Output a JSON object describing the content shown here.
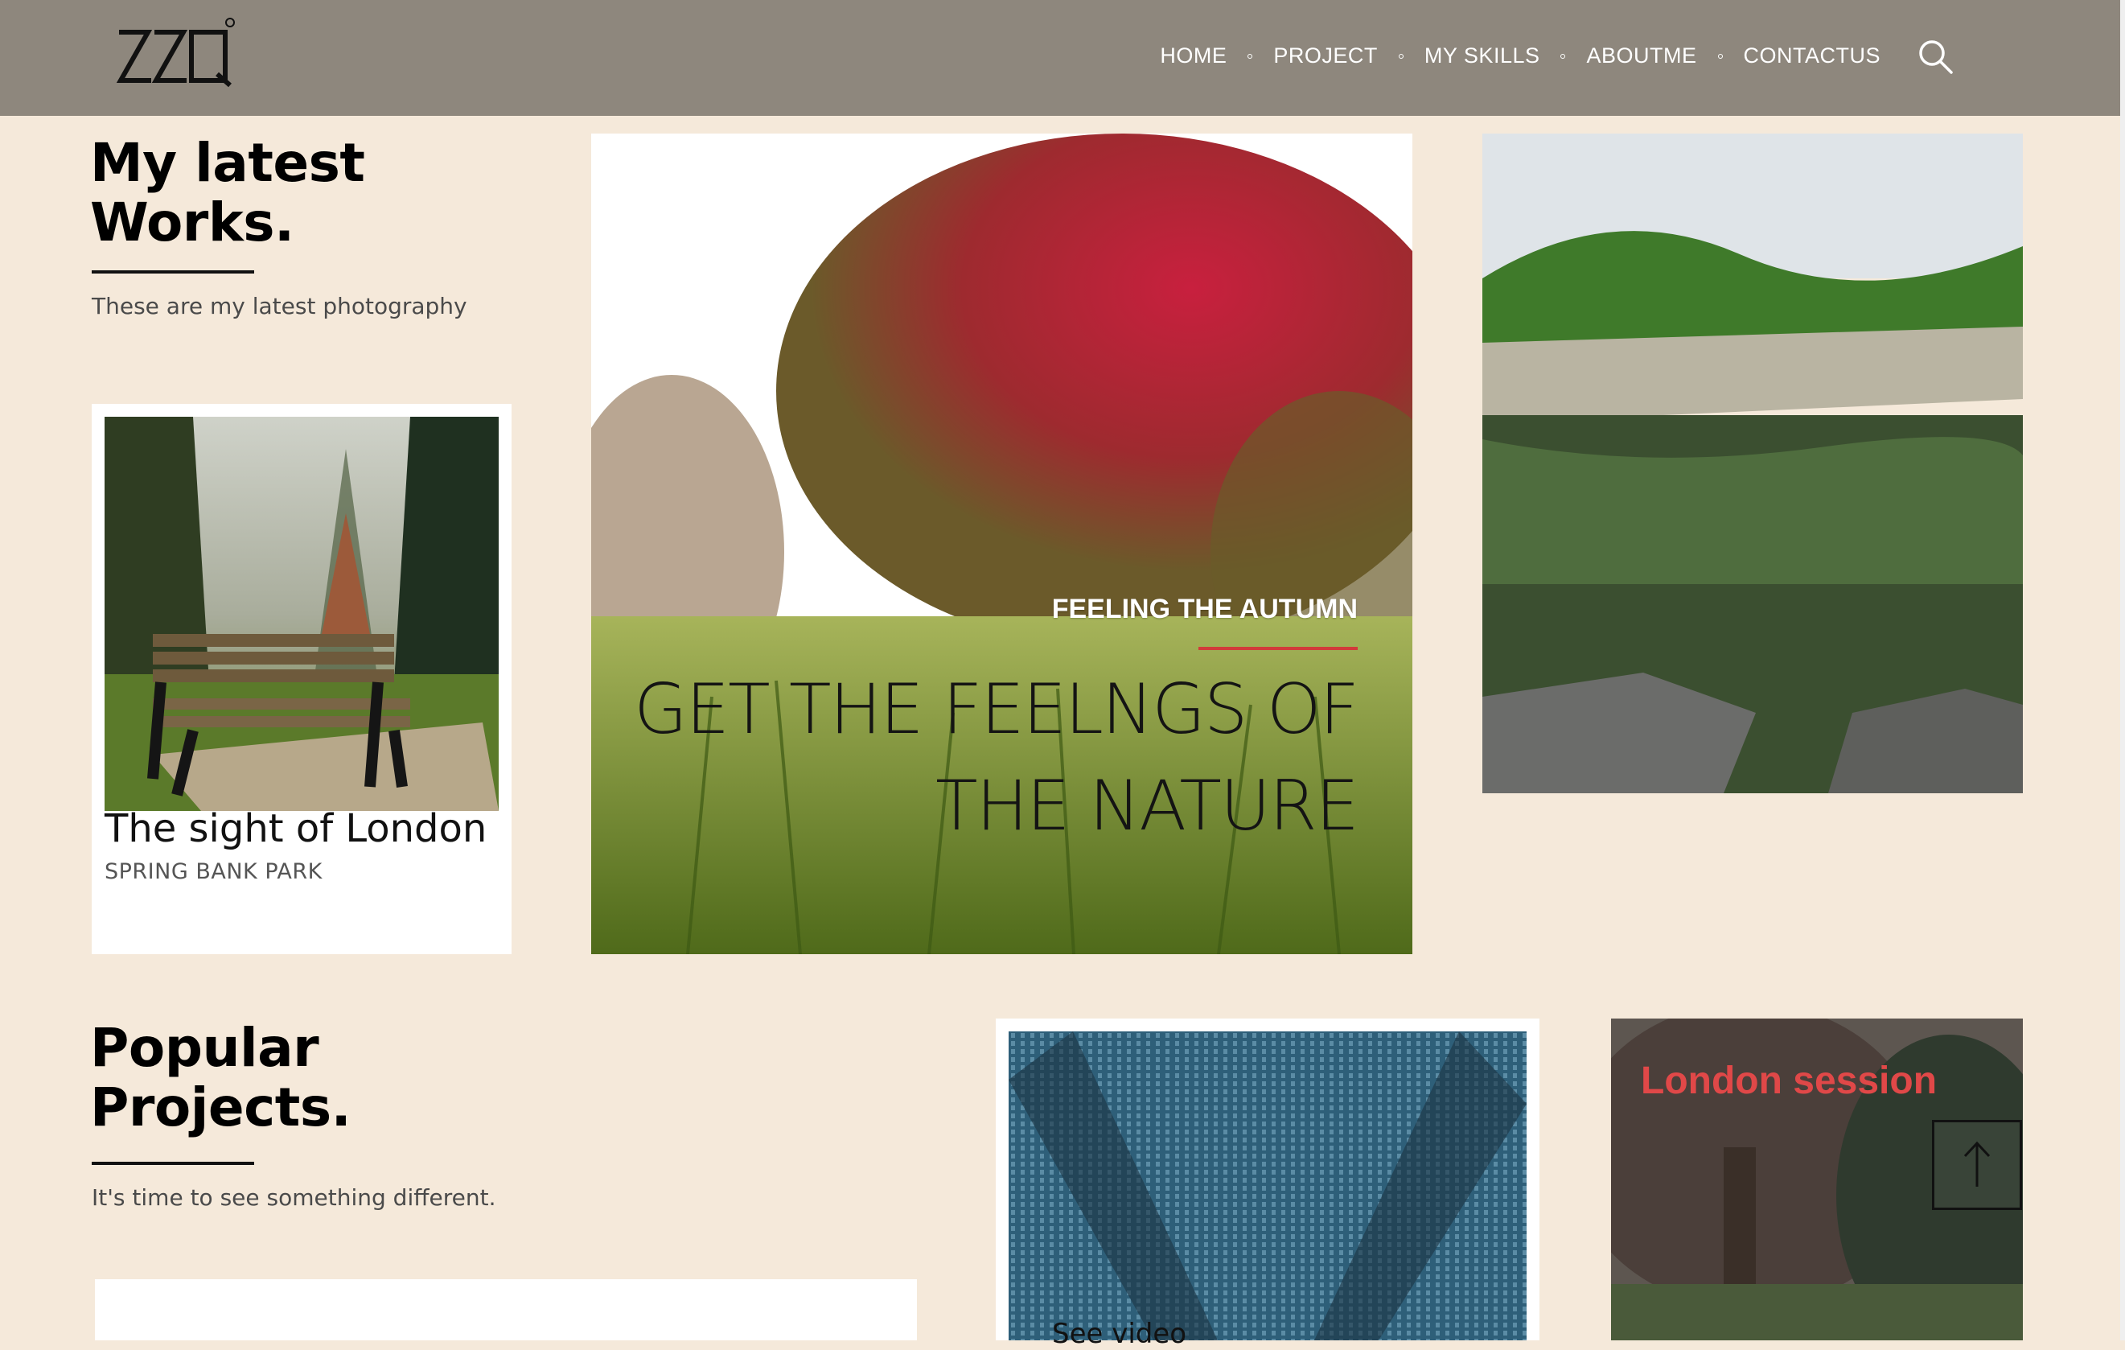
{
  "header": {
    "logo_alt": "ZZQ logo",
    "nav": [
      "HOME",
      "PROJECT",
      "MY SKILLS",
      "ABOUTME",
      "CONTACTUS"
    ],
    "search_icon": "search-icon"
  },
  "latest_works": {
    "title_line1": "My latest",
    "title_line2": "Works.",
    "subtitle": "These are my latest photography"
  },
  "card_london": {
    "title": "The sight of London",
    "subtitle": "SPRING BANK PARK"
  },
  "feature": {
    "eyebrow": "FEELING THE AUTUMN",
    "headline_line1": "GET THE FEELNGS OF",
    "headline_line2": "THE NATURE"
  },
  "popular_projects": {
    "title_line1": "Popular",
    "title_line2": "Projects.",
    "subtitle": "It's time to see something different."
  },
  "video_card": {
    "label": "See video"
  },
  "london_session": {
    "label": "London session"
  },
  "colors": {
    "header_bg": "#8e877d",
    "page_bg": "#f5e9da",
    "accent_red": "#d23a3a"
  }
}
